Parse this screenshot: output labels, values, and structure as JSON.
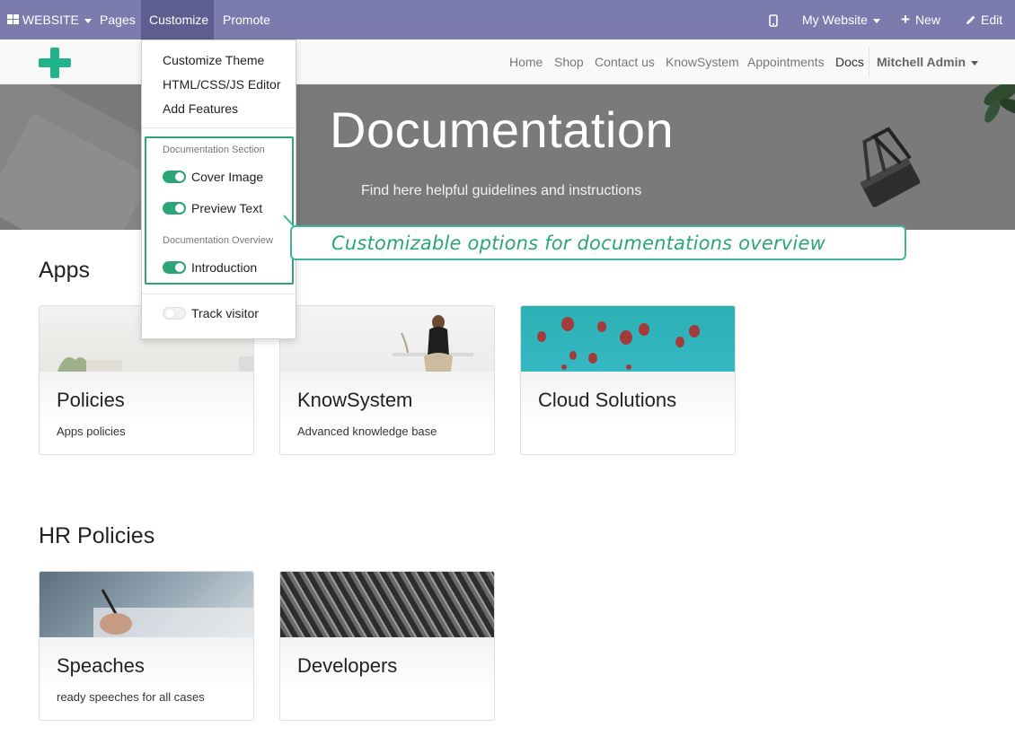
{
  "adminbar": {
    "website_label": "WEBSITE",
    "pages_label": "Pages",
    "customize_label": "Customize",
    "promote_label": "Promote",
    "site_selector": "My Website",
    "new_label": "New",
    "edit_label": "Edit",
    "bg_color": "#7c7bad"
  },
  "nav": {
    "items": [
      "Home",
      "Shop",
      "Contact us",
      "KnowSystem",
      "Appointments",
      "Docs"
    ],
    "current": "Docs",
    "user": "Mitchell Admin"
  },
  "banner": {
    "title": "Documentation",
    "subtitle": "Find here helpful guidelines and instructions"
  },
  "customize_menu": {
    "items": [
      "Customize Theme",
      "HTML/CSS/JS Editor",
      "Add Features"
    ],
    "section1_header": "Documentation Section",
    "cover_image": "Cover Image",
    "preview_text": "Preview Text",
    "section2_header": "Documentation Overview",
    "introduction": "Introduction",
    "track_visitor": "Track visitor",
    "toggles": {
      "cover_image": true,
      "preview_text": true,
      "introduction": true,
      "track_visitor": false
    }
  },
  "callout": {
    "text": "Customizable options for documentations overview",
    "color": "#2ba674"
  },
  "sections": [
    {
      "title": "Apps",
      "cards": [
        {
          "title": "Policies",
          "desc": "Apps policies"
        },
        {
          "title": "KnowSystem",
          "desc": "Advanced knowledge base"
        },
        {
          "title": "Cloud Solutions",
          "desc": ""
        }
      ]
    },
    {
      "title": "HR Policies",
      "cards": [
        {
          "title": "Speaches",
          "desc": "ready speeches for all cases"
        },
        {
          "title": "Developers",
          "desc": ""
        }
      ]
    }
  ]
}
